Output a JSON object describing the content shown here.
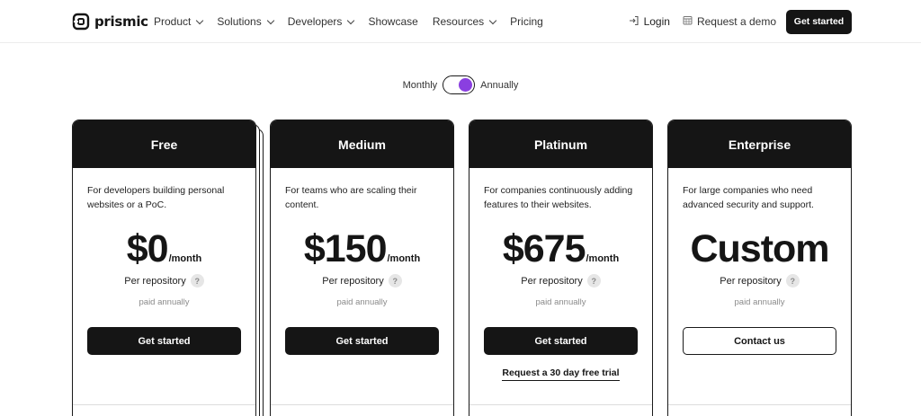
{
  "brand": {
    "name": "prismic"
  },
  "nav": {
    "links": [
      {
        "label": "Product",
        "dropdown": true
      },
      {
        "label": "Solutions",
        "dropdown": true
      },
      {
        "label": "Developers",
        "dropdown": true
      },
      {
        "label": "Showcase",
        "dropdown": false
      },
      {
        "label": "Resources",
        "dropdown": true
      },
      {
        "label": "Pricing",
        "dropdown": false
      }
    ],
    "login_label": "Login",
    "demo_label": "Request a demo",
    "cta_label": "Get started"
  },
  "billing": {
    "monthly_label": "Monthly",
    "annually_label": "Annually",
    "selected": "Annually",
    "accent": "#8a3fe0"
  },
  "plans": [
    {
      "name": "Free",
      "description": "For developers building personal websites or a PoC.",
      "price": "$0",
      "period": "/month",
      "unit": "Per repository",
      "note": "paid annually",
      "button": "Get started",
      "trial": ""
    },
    {
      "name": "Medium",
      "description": "For teams who are scaling their content.",
      "price": "$150",
      "period": "/month",
      "unit": "Per repository",
      "note": "paid annually",
      "button": "Get started",
      "trial": ""
    },
    {
      "name": "Platinum",
      "description": "For companies continuously adding features to their websites.",
      "price": "$675",
      "period": "/month",
      "unit": "Per repository",
      "note": "paid annually",
      "button": "Get started",
      "trial": "Request a 30 day free trial"
    },
    {
      "name": "Enterprise",
      "description": "For large companies who need advanced security and support.",
      "price": "Custom",
      "period": "",
      "unit": "Per repository",
      "note": "paid annually",
      "button": "Contact us",
      "trial": ""
    }
  ],
  "help_glyph": "?"
}
